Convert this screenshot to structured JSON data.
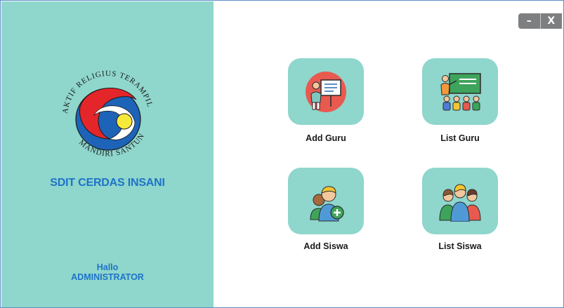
{
  "sidebar": {
    "school_name": "SDIT CERDAS INSANI",
    "greeting": "Hallo",
    "user_name": "ADMINISTRATOR",
    "logo_words": [
      "RELIGIUS",
      "TERAMPIL",
      "SANTUN",
      "MANDIRI",
      "AKTIF"
    ]
  },
  "window": {
    "minimize_label": "–",
    "close_label": "X"
  },
  "menu": [
    {
      "label": "Add Guru",
      "icon": "teacher-presentation-icon"
    },
    {
      "label": "List Guru",
      "icon": "classroom-icon"
    },
    {
      "label": "Add Siswa",
      "icon": "add-student-icon"
    },
    {
      "label": "List Siswa",
      "icon": "student-group-icon"
    }
  ],
  "colors": {
    "accent": "#8fd6cc",
    "text_blue": "#1e73c8",
    "control_gray": "#7d7f81",
    "border": "#5b8fc7"
  }
}
